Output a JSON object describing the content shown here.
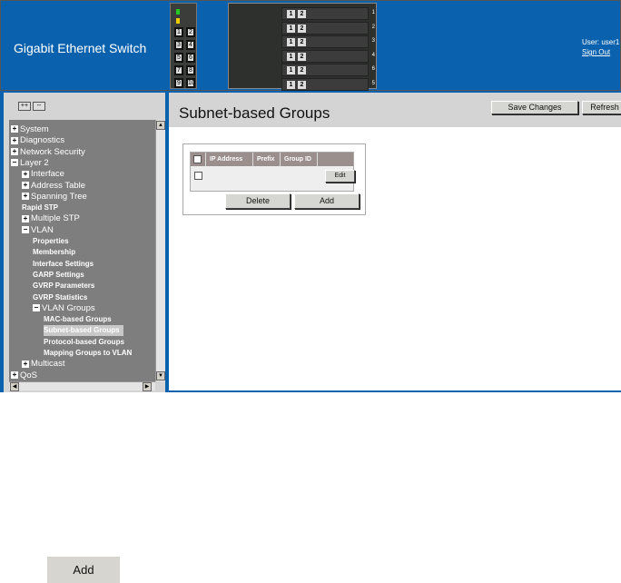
{
  "header": {
    "title": "Gigabit Ethernet Switch",
    "user_label": "User: user1",
    "sign_out": "Sign Out",
    "switch_ports": [
      "1",
      "2",
      "3",
      "4",
      "5",
      "6",
      "7",
      "8",
      "9",
      "10"
    ],
    "blade_numbers": [
      "1",
      "2",
      "3",
      "4",
      "6",
      "5"
    ],
    "blade_ports": [
      "1",
      "2"
    ]
  },
  "sidebar": {
    "expand_all": "++",
    "collapse_all": "--",
    "items": [
      {
        "label": "System",
        "level": 0,
        "icon": "plus",
        "bold": false
      },
      {
        "label": "Diagnostics",
        "level": 0,
        "icon": "plus",
        "bold": false
      },
      {
        "label": "Network Security",
        "level": 0,
        "icon": "plus",
        "bold": false
      },
      {
        "label": "Layer 2",
        "level": 0,
        "icon": "minus",
        "bold": false
      },
      {
        "label": "Interface",
        "level": 1,
        "icon": "plus",
        "bold": false
      },
      {
        "label": "Address Table",
        "level": 1,
        "icon": "plus",
        "bold": false
      },
      {
        "label": "Spanning Tree",
        "level": 1,
        "icon": "plus",
        "bold": false
      },
      {
        "label": "Rapid STP",
        "level": 1,
        "icon": "",
        "bold": true
      },
      {
        "label": "Multiple STP",
        "level": 1,
        "icon": "plus",
        "bold": false
      },
      {
        "label": "VLAN",
        "level": 1,
        "icon": "minus",
        "bold": false
      },
      {
        "label": "Properties",
        "level": 2,
        "icon": "",
        "bold": true
      },
      {
        "label": "Membership",
        "level": 2,
        "icon": "",
        "bold": true
      },
      {
        "label": "Interface Settings",
        "level": 2,
        "icon": "",
        "bold": true
      },
      {
        "label": "GARP Settings",
        "level": 2,
        "icon": "",
        "bold": true
      },
      {
        "label": "GVRP Parameters",
        "level": 2,
        "icon": "",
        "bold": true
      },
      {
        "label": "GVRP Statistics",
        "level": 2,
        "icon": "",
        "bold": true
      },
      {
        "label": "VLAN Groups",
        "level": 2,
        "icon": "minus",
        "bold": false
      },
      {
        "label": "MAC-based Groups",
        "level": 3,
        "icon": "",
        "bold": true
      },
      {
        "label": "Subnet-based Groups",
        "level": 3,
        "icon": "",
        "bold": true,
        "selected": true
      },
      {
        "label": "Protocol-based Groups",
        "level": 3,
        "icon": "",
        "bold": true
      },
      {
        "label": "Mapping Groups to VLAN",
        "level": 3,
        "icon": "",
        "bold": true
      },
      {
        "label": "Multicast",
        "level": 1,
        "icon": "plus",
        "bold": false
      },
      {
        "label": "QoS",
        "level": 0,
        "icon": "plus",
        "bold": false
      }
    ]
  },
  "main": {
    "title": "Subnet-based Groups",
    "save_changes": "Save Changes",
    "refresh": "Refresh",
    "table": {
      "columns": [
        "IP Address",
        "Prefix",
        "Group ID"
      ],
      "edit": "Edit"
    },
    "delete": "Delete",
    "add": "Add"
  },
  "footer": {
    "add": "Add"
  }
}
